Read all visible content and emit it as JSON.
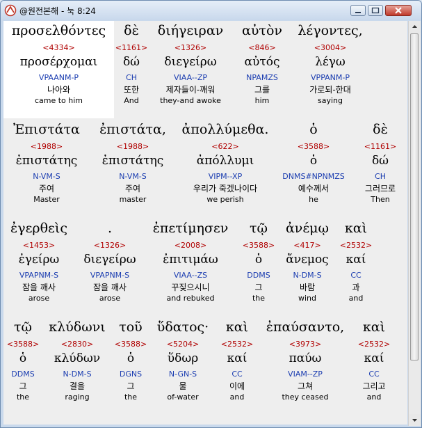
{
  "window": {
    "title": "@원전본해 - 눅 8:24",
    "colors": {
      "accent_red": "#b00000",
      "parse_blue": "#1a3cb0",
      "highlight": "#ffffff"
    }
  },
  "rows": [
    {
      "tokens": [
        {
          "greek": "προσελθόντες",
          "num": "<4334>",
          "lemma": "προσέρχομαι",
          "parse": "VPAANM-P",
          "korean": "나아와",
          "english": "came to him",
          "highlighted": true
        },
        {
          "greek": "δὲ",
          "num": "<1161>",
          "lemma": "δώ",
          "parse": "CH",
          "korean": "또한",
          "english": "And"
        },
        {
          "greek": "διήγειραν",
          "num": "<1326>",
          "lemma": "διεγείρω",
          "parse": "VIAA--ZP",
          "korean": "제자들이-깨워",
          "english": "they-and awoke"
        },
        {
          "greek": "αὐτὸν",
          "num": "<846>",
          "lemma": "αὐτός",
          "parse": "NPAMZS",
          "korean": "그를",
          "english": "him"
        },
        {
          "greek": "λέγοντες,",
          "num": "<3004>",
          "lemma": "λέγω",
          "parse": "VPPANM-P",
          "korean": "가로되-한대",
          "english": "saying"
        }
      ]
    },
    {
      "tokens": [
        {
          "greek": "Ἐπιστάτα",
          "num": "<1988>",
          "lemma": "ἐπιστάτης",
          "parse": "N-VM-S",
          "korean": "주여",
          "english": "Master"
        },
        {
          "greek": "ἐπιστάτα,",
          "num": "<1988>",
          "lemma": "ἐπιστάτης",
          "parse": "N-VM-S",
          "korean": "주여",
          "english": "master"
        },
        {
          "greek": "ἀπολλύμεθα.",
          "num": "<622>",
          "lemma": "ἀπόλλυμι",
          "parse": "VIPM--XP",
          "korean": "우리가 죽겠나이다",
          "english": "we perish"
        },
        {
          "greek": "ὁ",
          "num": "<3588>",
          "lemma": "ὁ",
          "parse": "DNMS#NPNMZS",
          "korean": "예수께서",
          "english": "he"
        },
        {
          "greek": "δὲ",
          "num": "<1161>",
          "lemma": "δώ",
          "parse": "CH",
          "korean": "그러므로",
          "english": "Then"
        }
      ]
    },
    {
      "tokens": [
        {
          "greek": "ἐγερθεὶς",
          "num": "<1453>",
          "lemma": "ἐγείρω",
          "parse": "VPAPNM-S",
          "korean": "잠을 깨사",
          "english": "arose"
        },
        {
          "greek": ".",
          "num": "<1326>",
          "lemma": "διεγείρω",
          "parse": "VPAPNM-S",
          "korean": "잠을 깨사",
          "english": "arose"
        },
        {
          "greek": "ἐπετίμησεν",
          "num": "<2008>",
          "lemma": "ἐπιτιμάω",
          "parse": "VIAA--ZS",
          "korean": "꾸짖으시니",
          "english": "and rebuked"
        },
        {
          "greek": "τῷ",
          "num": "<3588>",
          "lemma": "ὁ",
          "parse": "DDMS",
          "korean": "그",
          "english": "the"
        },
        {
          "greek": "ἀνέμῳ",
          "num": "<417>",
          "lemma": "ἄνεμος",
          "parse": "N-DM-S",
          "korean": "바람",
          "english": "wind"
        },
        {
          "greek": "καὶ",
          "num": "<2532>",
          "lemma": "καί",
          "parse": "CC",
          "korean": "과",
          "english": "and"
        }
      ]
    },
    {
      "tokens": [
        {
          "greek": "τῷ",
          "num": "<3588>",
          "lemma": "ὁ",
          "parse": "DDMS",
          "korean": "그",
          "english": "the"
        },
        {
          "greek": "κλύδωνι",
          "num": "<2830>",
          "lemma": "κλύδων",
          "parse": "N-DM-S",
          "korean": "결을",
          "english": "raging"
        },
        {
          "greek": "τοῦ",
          "num": "<3588>",
          "lemma": "ὁ",
          "parse": "DGNS",
          "korean": "그",
          "english": "the"
        },
        {
          "greek": "ὕδατος·",
          "num": "<5204>",
          "lemma": "ὕδωρ",
          "parse": "N-GN-S",
          "korean": "물",
          "english": "of-water"
        },
        {
          "greek": "καὶ",
          "num": "<2532>",
          "lemma": "καί",
          "parse": "CC",
          "korean": "이에",
          "english": "and"
        },
        {
          "greek": "ἐπαύσαντο,",
          "num": "<3973>",
          "lemma": "παύω",
          "parse": "VIAM--ZP",
          "korean": "그쳐",
          "english": "they ceased"
        },
        {
          "greek": "καὶ",
          "num": "<2532>",
          "lemma": "καί",
          "parse": "CC",
          "korean": "그리고",
          "english": "and"
        }
      ]
    }
  ]
}
